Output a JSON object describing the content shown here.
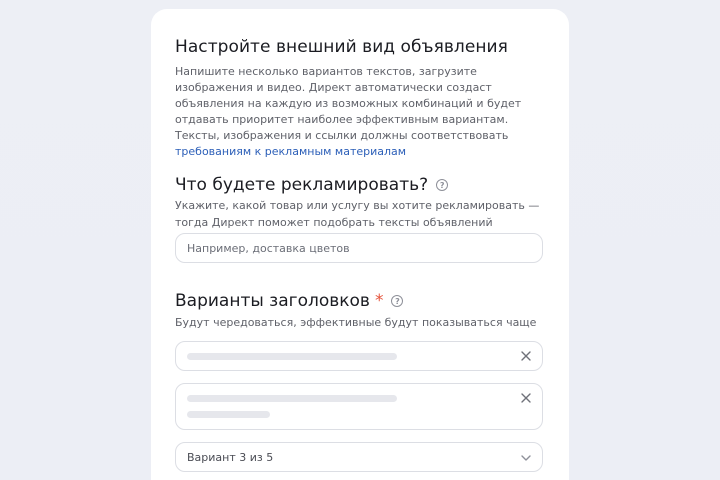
{
  "section": {
    "title": "Настройте внешний вид объявления",
    "description": "Напишите несколько вариантов текстов, загрузите изображения и видео. Директ автоматически создаст объявления на каждую из возможных комбинаций и будет отдавать приоритет наиболее эффективным вариантам. Тексты, изображения и ссылки должны соответствовать ",
    "requirements_link": "требованиям к рекламным материалам"
  },
  "promote": {
    "heading": "Что будете рекламировать?",
    "hint": "Укажите, какой товар или услугу вы хотите рекламировать — тогда Директ поможет подобрать тексты объявлений",
    "input_placeholder": "Например, доставка цветов"
  },
  "headlines": {
    "heading": "Варианты заголовков",
    "required_mark": "*",
    "hint": "Будут чередоваться, эффективные будут показываться чаще",
    "variant_selector": "Вариант 3 из 5"
  },
  "colors": {
    "accent_link": "#2c5fb8",
    "required_star": "#e5533c",
    "background": "#eef0f6",
    "card": "#ffffff"
  }
}
